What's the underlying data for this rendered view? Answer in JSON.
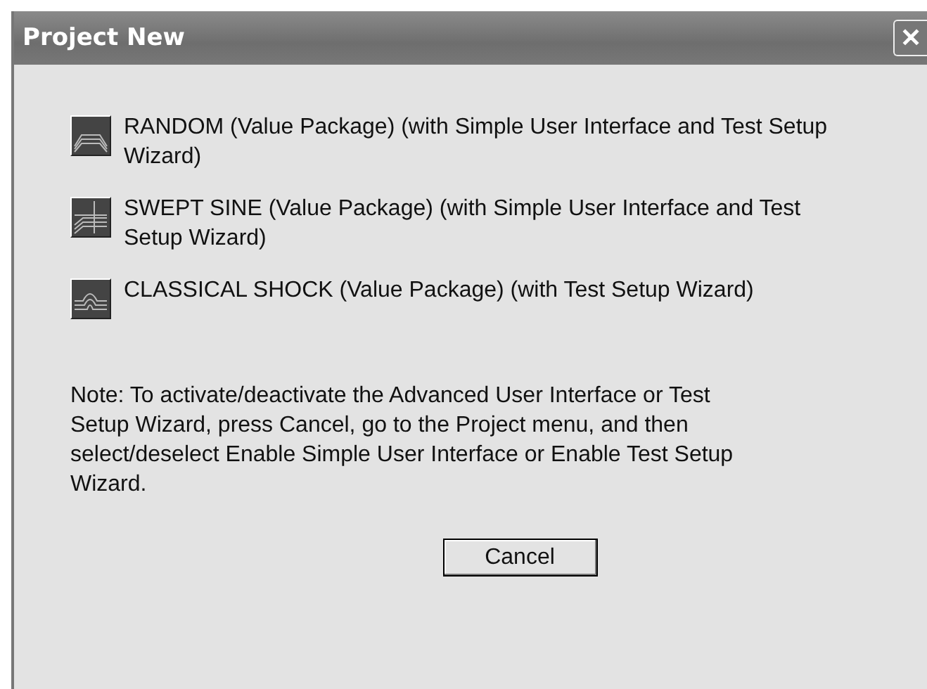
{
  "window": {
    "title": "Project New",
    "close": "✕"
  },
  "options": [
    {
      "kind": "random",
      "label": "RANDOM (Value Package) (with Simple User Interface and Test Setup Wizard)"
    },
    {
      "kind": "swept",
      "label": "SWEPT SINE (Value Package) (with Simple User Interface and Test Setup Wizard)"
    },
    {
      "kind": "shock",
      "label": "CLASSICAL SHOCK (Value Package) (with Test Setup Wizard)"
    }
  ],
  "note": "Note: To activate/deactivate the Advanced User Interface or Test Setup Wizard, press Cancel, go to the Project menu, and then select/deselect Enable Simple User Interface or Enable Test Setup Wizard.",
  "buttons": [
    "Cancel"
  ]
}
